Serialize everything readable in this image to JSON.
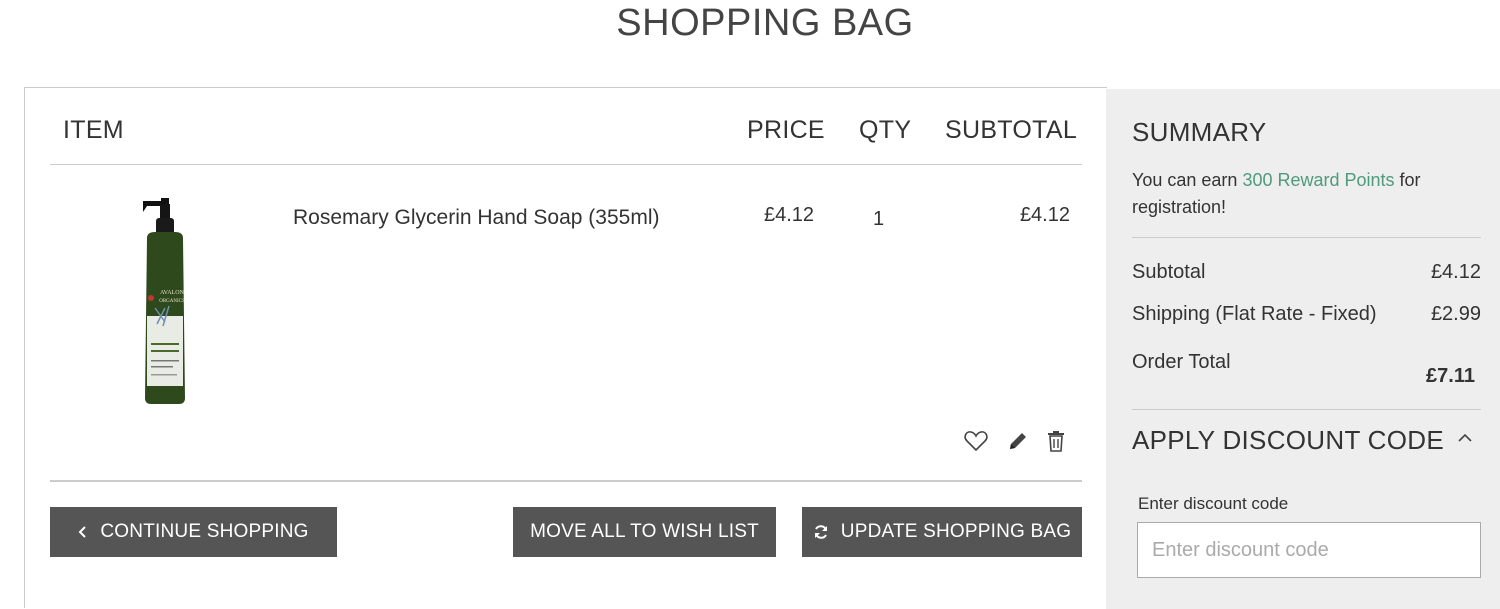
{
  "page": {
    "title": "SHOPPING BAG"
  },
  "cart": {
    "headers": {
      "item": "ITEM",
      "price": "PRICE",
      "qty": "QTY",
      "subtotal": "SUBTOTAL"
    },
    "items": [
      {
        "name": "Rosemary Glycerin Hand Soap (355ml)",
        "price": "£4.12",
        "qty": "1",
        "subtotal": "£4.12",
        "image_icon": "hand-soap-bottle",
        "image_brand": "AVALON ORGANICS",
        "image_variant": "Rejuvenating Rosemary"
      }
    ],
    "buttons": {
      "continue": "CONTINUE SHOPPING",
      "wishlist_all": "MOVE ALL TO WISH LIST",
      "update": "UPDATE SHOPPING BAG"
    },
    "item_action_icons": [
      "heart-icon",
      "pencil-icon",
      "trash-icon"
    ]
  },
  "summary": {
    "title": "SUMMARY",
    "reward_prefix": "You can earn ",
    "reward_link": "300 Reward Points",
    "reward_suffix": " for registration!",
    "rows": [
      {
        "label": "Subtotal",
        "value": "£4.12"
      },
      {
        "label": "Shipping (Flat Rate - Fixed)",
        "value": "£2.99"
      }
    ],
    "order_total_label": "Order Total",
    "order_total_value": "£7.11",
    "discount": {
      "title": "APPLY DISCOUNT CODE",
      "label": "Enter discount code",
      "placeholder": "Enter discount code",
      "value": ""
    }
  },
  "colors": {
    "button_bg": "#555555",
    "summary_bg": "#eeeeee",
    "reward_link": "#4f9a7d",
    "text": "#333333"
  }
}
